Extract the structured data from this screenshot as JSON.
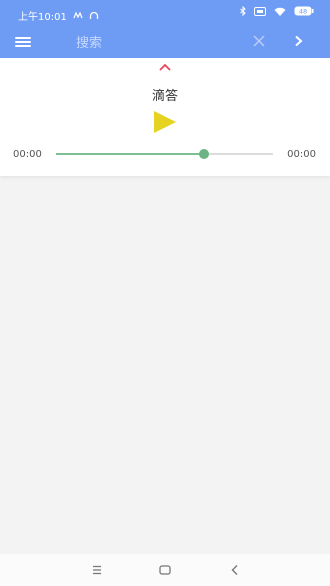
{
  "status_bar": {
    "time": "上午10:01",
    "battery_icon": "battery-icon",
    "wifi_icon": "wifi-icon",
    "bluetooth_icon": "bluetooth-icon"
  },
  "app_bar": {
    "background": "#6e9cf5",
    "menu_icon": "hamburger-menu-icon",
    "search": {
      "placeholder": "搜索",
      "value": ""
    },
    "clear_icon": "close-icon",
    "next_icon": "chevron-right-icon"
  },
  "player": {
    "collapse_icon": "chevron-up-icon",
    "title": "滴答",
    "play_icon": "play-icon",
    "time_current": "00:00",
    "time_total": "00:00",
    "progress": 0.68,
    "progress_color": "#7bbf92",
    "play_color": "#e6d321"
  },
  "nav_bar": {
    "menu_icon": "menu-lines-icon",
    "home_icon": "home-square-icon",
    "back_icon": "back-chevron-icon"
  }
}
